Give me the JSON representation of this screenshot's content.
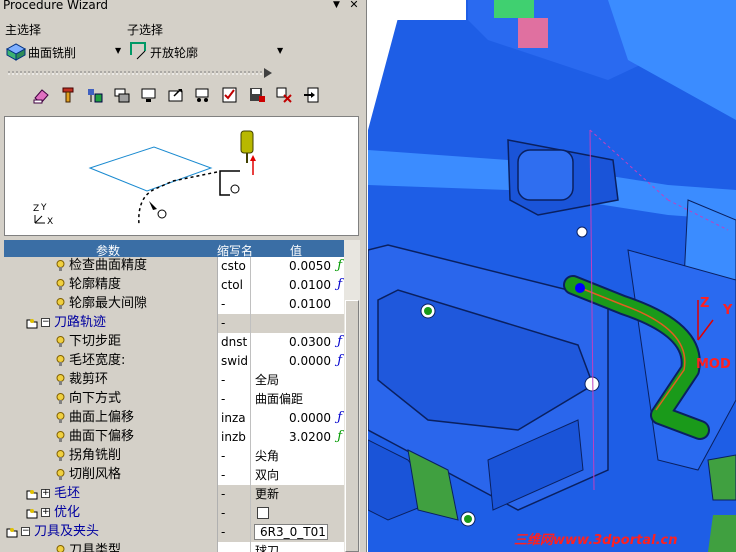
{
  "window": {
    "title": "Procedure Wizard",
    "pin_glyph": "▼",
    "close_glyph": "✕"
  },
  "main_select": {
    "label": "主选择",
    "value": "曲面铣削",
    "icon": "surface-mill-icon"
  },
  "sub_select": {
    "label": "子选择",
    "value": "开放轮廓",
    "icon": "open-contour-icon"
  },
  "toolbar": {
    "icons": [
      "eraser-icon",
      "tool-icon",
      "tool-holder-icon",
      "stock-icon",
      "monitor-icon",
      "folder-arrow-icon",
      "machine-icon",
      "checklist-icon",
      "save-icon",
      "settings-icon",
      "export-icon"
    ]
  },
  "grid": {
    "headers": {
      "param": "参数",
      "abbr": "缩写名",
      "value": "值"
    },
    "rows": [
      {
        "name": "检查曲面精度",
        "abbr": "csto",
        "value": "0.0050",
        "fx": "ƒ",
        "fx_color": "#009900",
        "type": "num",
        "group": false
      },
      {
        "name": "轮廓精度",
        "abbr": "ctol",
        "value": "0.0100",
        "fx": "ƒ",
        "fx_color": "#0000cc",
        "type": "num",
        "group": false
      },
      {
        "name": "轮廓最大间隙",
        "abbr": "-",
        "value": "0.0100",
        "fx": "",
        "fx_color": "",
        "type": "num",
        "group": false
      },
      {
        "name": "刀路轨迹",
        "abbr": "-",
        "value": "",
        "fx": "",
        "fx_color": "",
        "type": "text",
        "group": true,
        "expander": "⊟"
      },
      {
        "name": "下切步距",
        "abbr": "dnst",
        "value": "0.0300",
        "fx": "ƒ",
        "fx_color": "#0000cc",
        "type": "num",
        "group": false
      },
      {
        "name": "毛坯宽度:",
        "abbr": "swid",
        "value": "0.0000",
        "fx": "ƒ",
        "fx_color": "#0000cc",
        "type": "num",
        "group": false
      },
      {
        "name": "裁剪环",
        "abbr": "-",
        "value": "全局",
        "fx": "",
        "fx_color": "",
        "type": "text",
        "group": false
      },
      {
        "name": "向下方式",
        "abbr": "-",
        "value": "曲面偏距",
        "fx": "",
        "fx_color": "",
        "type": "text",
        "group": false
      },
      {
        "name": "曲面上偏移",
        "abbr": "inza",
        "value": "0.0000",
        "fx": "ƒ",
        "fx_color": "#0000cc",
        "type": "num",
        "group": false
      },
      {
        "name": "曲面下偏移",
        "abbr": "inzb",
        "value": "3.0200",
        "fx": "ƒ",
        "fx_color": "#009900",
        "type": "num",
        "group": false
      },
      {
        "name": "拐角铣削",
        "abbr": "-",
        "value": "尖角",
        "fx": "",
        "fx_color": "",
        "type": "text",
        "group": false
      },
      {
        "name": "切削风格",
        "abbr": "-",
        "value": "双向",
        "fx": "",
        "fx_color": "",
        "type": "text",
        "group": false
      },
      {
        "name": "毛坯",
        "abbr": "-",
        "value": "更新",
        "fx": "",
        "fx_color": "",
        "type": "text",
        "group": true,
        "expander": "⊞"
      },
      {
        "name": "优化",
        "abbr": "-",
        "value": "",
        "fx": "",
        "fx_color": "",
        "type": "check",
        "group": true,
        "expander": "⊞"
      },
      {
        "name": "刀具及夹头",
        "abbr": "-",
        "value": "6R3_0_T01",
        "fx": "",
        "fx_color": "",
        "type": "combo",
        "group": true,
        "expander": "⊟"
      },
      {
        "name": "刀具类型",
        "abbr": "",
        "value": "球刀",
        "fx": "",
        "fx_color": "",
        "type": "text",
        "group": false
      }
    ]
  },
  "viewport": {
    "axis_labels": {
      "z": "Z",
      "y": "Y",
      "mod": "MOD"
    },
    "preview_axes": {
      "z": "Z",
      "y": "Y",
      "x": "X"
    }
  },
  "watermark": "三维网www.3dportal.cn",
  "colors": {
    "part_blue": "#1e5ee6",
    "part_light": "#3b8cff",
    "path_green": "#1a9a1a",
    "selection_blue": "#3a6ea5",
    "wizard_bg": "#d4d0c8"
  }
}
